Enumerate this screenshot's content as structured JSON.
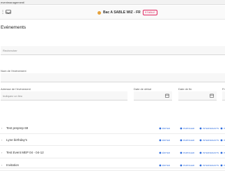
{
  "browser": {
    "url_fragment": "eventmanagement/"
  },
  "header": {
    "store_name": "Bac A SABLE WIZ - FR",
    "env_badge": "STABLE",
    "env_color": "#e0245e"
  },
  "page": {
    "title": "Evénements"
  },
  "search": {
    "placeholder": "Rechercher"
  },
  "form": {
    "event_name_label": "Nom de l'événement",
    "address_label": "Adresse de l'événement",
    "address_placeholder": "Indiquez un lieu",
    "start_date_label": "Date de début",
    "end_date_label": "Date de fin",
    "extra_label": "Fr"
  },
  "actions": {
    "edit": "Éditer",
    "share": "Partager",
    "attendees": "Intervenants",
    "more": "In"
  },
  "events": [
    {
      "name": "Test preprep 69"
    },
    {
      "name": "Lyne birthday's"
    },
    {
      "name": "Test Event MEP 04 - 04-12"
    },
    {
      "name": "Invitation"
    }
  ],
  "icons": {
    "menu": "hamburger-menu-icon",
    "inbox": "inbox-icon",
    "calendar": "calendar-icon",
    "chevron": "chevron-right-icon"
  },
  "colors": {
    "accent": "#2d6cdf",
    "store_dot": "#e6a23c"
  }
}
